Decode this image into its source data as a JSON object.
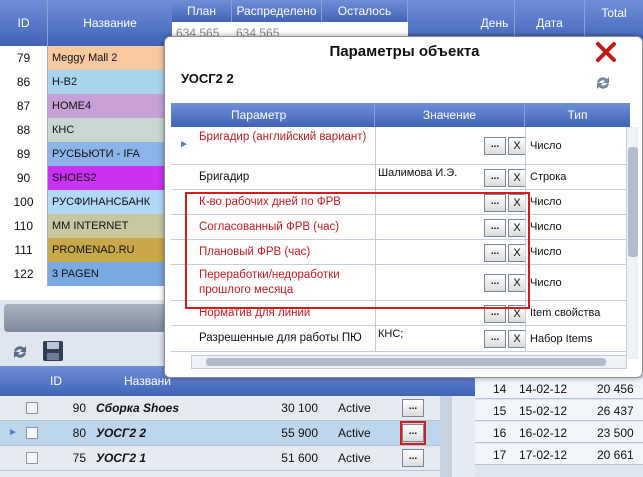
{
  "top_grid": {
    "headers": [
      "ID",
      "Название"
    ],
    "rows": [
      {
        "id": "79",
        "name": "Meggy Mall 2",
        "color": "#f8c8a0"
      },
      {
        "id": "86",
        "name": "H-B2",
        "color": "#a8d4f0"
      },
      {
        "id": "87",
        "name": "HOME4",
        "color": "#c8a0d8"
      },
      {
        "id": "88",
        "name": "КНС",
        "color": "#c8d8d0"
      },
      {
        "id": "89",
        "name": "РУСБЬЮТИ - IFA",
        "color": "#8cb4e8"
      },
      {
        "id": "90",
        "name": "SHOES2",
        "color": "#c832f0"
      },
      {
        "id": "100",
        "name": "РУСФИНАНСБАНК",
        "color": "#b0d8f8"
      },
      {
        "id": "110",
        "name": "MM INTERNET",
        "color": "#c8c8a0"
      },
      {
        "id": "111",
        "name": "PROMENAD.RU",
        "color": "#c8a848"
      },
      {
        "id": "122",
        "name": "3 PAGEN",
        "color": "#7aa8e0"
      }
    ]
  },
  "top_right_header": {
    "plan": "План",
    "distributed": "Распределено",
    "remaining": "Осталось",
    "plan_value": "634 565",
    "distributed_value": "634 565"
  },
  "date_grid": {
    "headers": [
      "День",
      "Дата",
      "Total"
    ],
    "rows": [
      {
        "day": "14",
        "date": "14-02-12",
        "total": "20 456"
      },
      {
        "day": "15",
        "date": "15-02-12",
        "total": "26 437"
      },
      {
        "day": "16",
        "date": "16-02-12",
        "total": "23 500"
      },
      {
        "day": "17",
        "date": "17-02-12",
        "total": "20 661"
      }
    ]
  },
  "bottom_grid": {
    "headers": [
      "ID",
      "Названи"
    ],
    "rows": [
      {
        "id": "90",
        "name": "Сборка Shoes",
        "amount": "30 100",
        "status": "Active",
        "selected": false
      },
      {
        "id": "80",
        "name": "УОСГ2 2",
        "amount": "55 900",
        "status": "Active",
        "selected": true
      },
      {
        "id": "75",
        "name": "УОСГ2 1",
        "amount": "51 600",
        "status": "Active",
        "selected": false
      }
    ],
    "button_label": "..."
  },
  "dialog": {
    "title": "Параметры объекта",
    "object_name": "УОСГ2 2",
    "columns": [
      "Параметр",
      "Значение",
      "Тип"
    ],
    "button_dots": "...",
    "button_clear": "X",
    "rows": [
      {
        "param": "Бригадир (английский вариант)",
        "value": "",
        "type": "Число",
        "red": true
      },
      {
        "param": "Бригадир",
        "value": "Шалимова И.Э.",
        "type": "Строка",
        "red": false
      },
      {
        "param": "К-во рабочих дней по ФРВ",
        "value": "",
        "type": "Число",
        "red": true
      },
      {
        "param": "Согласованный ФРВ (час)",
        "value": "",
        "type": "Число",
        "red": true
      },
      {
        "param": "Плановый ФРВ (час)",
        "value": "",
        "type": "Число",
        "red": true
      },
      {
        "param": "Переработки/недоработки прошлого месяца",
        "value": "",
        "type": "Число",
        "red": true
      },
      {
        "param": "Норматив для линий",
        "value": "",
        "type": "Item свойства",
        "red": true
      },
      {
        "param": "Разрешенные для работы ПЮ",
        "value": "КНС;",
        "type": "Набор Items",
        "red": false
      }
    ]
  }
}
